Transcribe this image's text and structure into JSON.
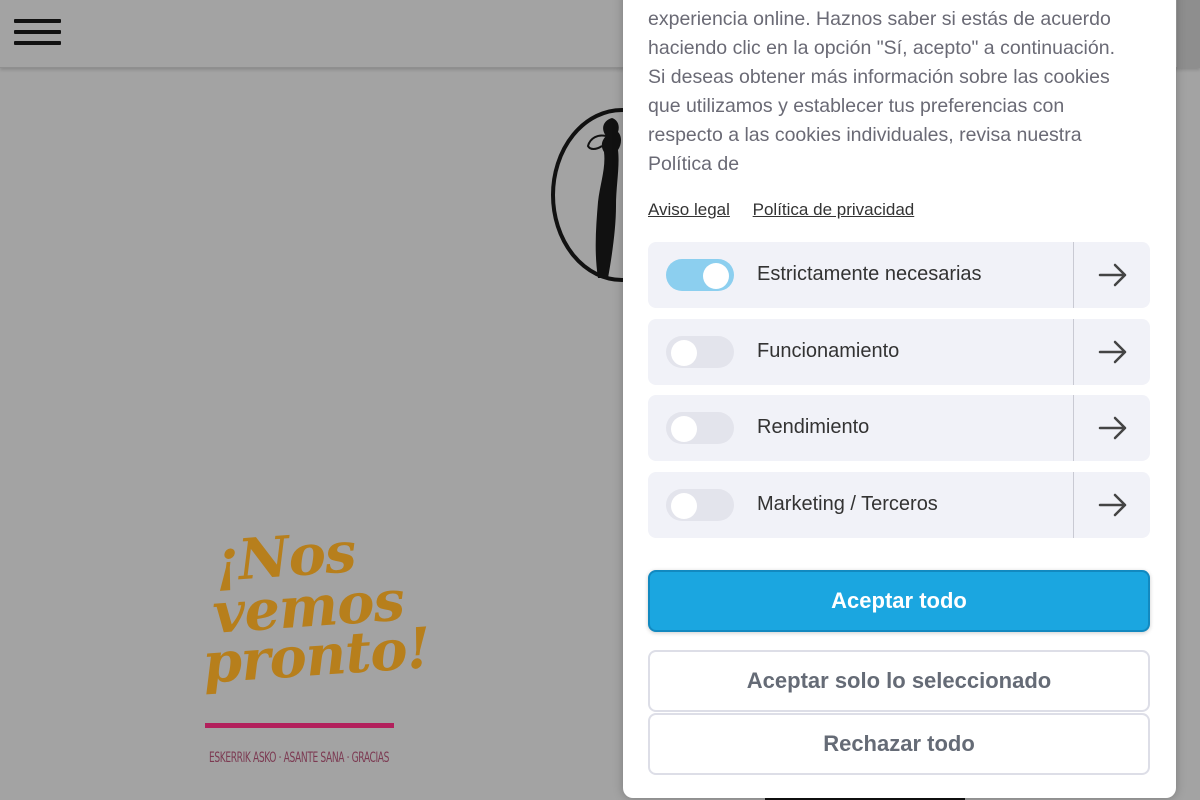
{
  "background": {
    "promo": {
      "line1": "¡Nos",
      "line2": "vemos",
      "line3": "pronto!",
      "subtitle": "ESKERRIK ASKO · ASANTE SANA · GRACIAS"
    }
  },
  "cookie_panel": {
    "description": "Esta página web utiliza cookies para brindarte la mejor experiencia online. Haznos saber si estás de acuerdo haciendo clic en la opción \"Sí, acepto\" a continuación. Si deseas obtener más información sobre las cookies que utilizamos y establecer tus preferencias con respecto a las cookies individuales, revisa nuestra Política de",
    "links": {
      "legal": "Aviso legal",
      "privacy": "Política de privacidad"
    },
    "categories": [
      {
        "label": "Estrictamente necesarias",
        "enabled": true
      },
      {
        "label": "Funcionamiento",
        "enabled": false
      },
      {
        "label": "Rendimiento",
        "enabled": false
      },
      {
        "label": "Marketing / Terceros",
        "enabled": false
      }
    ],
    "buttons": {
      "accept_all": "Aceptar todo",
      "accept_selected": "Aceptar solo lo seleccionado",
      "reject_all": "Rechazar todo"
    }
  },
  "colors": {
    "accent": "#1ba6e0",
    "toggle_on": "#8ccfef",
    "promo_text": "#b77f1c",
    "promo_rule": "#b2205c"
  }
}
